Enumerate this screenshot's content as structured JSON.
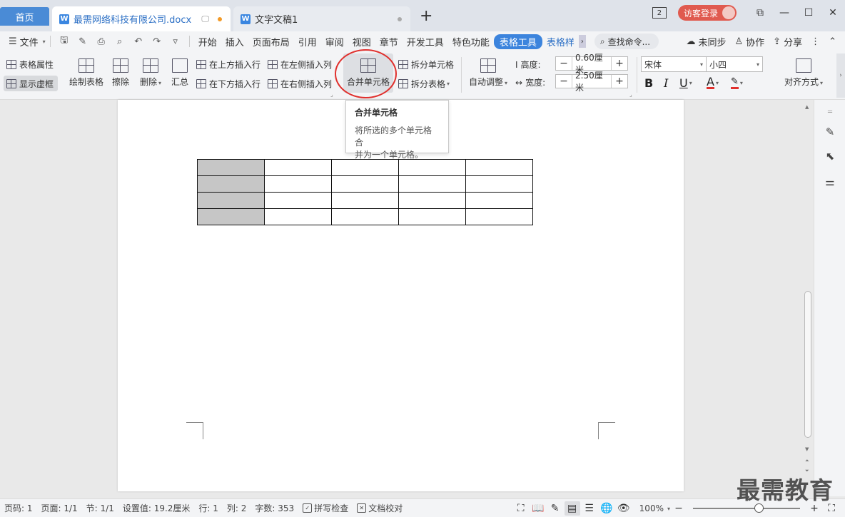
{
  "titlebar": {
    "home_tab": "首页",
    "doc_tab_active": "最需网络科技有限公司.docx",
    "doc_tab_inactive": "文字文稿1",
    "badge_count": "2",
    "login": "访客登录",
    "colors": {
      "home_tab": "#4a8bd6",
      "login_btn": "#e05a4f",
      "accent": "#2b6fc5"
    }
  },
  "menu": {
    "file": "文件",
    "items": [
      "开始",
      "插入",
      "页面布局",
      "引用",
      "审阅",
      "视图",
      "章节",
      "开发工具",
      "特色功能"
    ],
    "active_tab": "表格工具",
    "style_tab": "表格样",
    "search": "查找命令...",
    "right": {
      "sync": "未同步",
      "collab": "协作",
      "share": "分享"
    }
  },
  "ribbon": {
    "table_props": "表格属性",
    "show_grid": "显示虚框",
    "draw_table": "绘制表格",
    "erase": "擦除",
    "delete": "删除",
    "summary": "汇总",
    "insert_row_above": "在上方插入行",
    "insert_row_below": "在下方插入行",
    "insert_col_left": "在左侧插入列",
    "insert_col_right": "在右侧插入列",
    "merge_cells": "合并单元格",
    "split_cells": "拆分单元格",
    "split_table": "拆分表格",
    "auto_fit": "自动调整",
    "height_label": "高度:",
    "height_value": "0.60厘米",
    "width_label": "宽度:",
    "width_value": "2.50厘米",
    "font_name": "宋体",
    "font_size": "小四",
    "bold": "B",
    "italic": "I",
    "underline": "U",
    "font_color": "A",
    "align": "对齐方式"
  },
  "tooltip": {
    "title": "合并单元格",
    "desc_line1": "将所选的多个单元格合",
    "desc_line2": "并为一个单元格。"
  },
  "table": {
    "rows": 4,
    "cols": 5,
    "selected_col": 0
  },
  "status": {
    "page": "页码: 1",
    "pages": "页面: 1/1",
    "section": "节: 1/1",
    "setting": "设置值: 19.2厘米",
    "row": "行: 1",
    "col": "列: 2",
    "words": "字数: 353",
    "spell": "拼写检查",
    "proof": "文档校对",
    "zoom": "100%"
  },
  "watermark": "最需教育"
}
